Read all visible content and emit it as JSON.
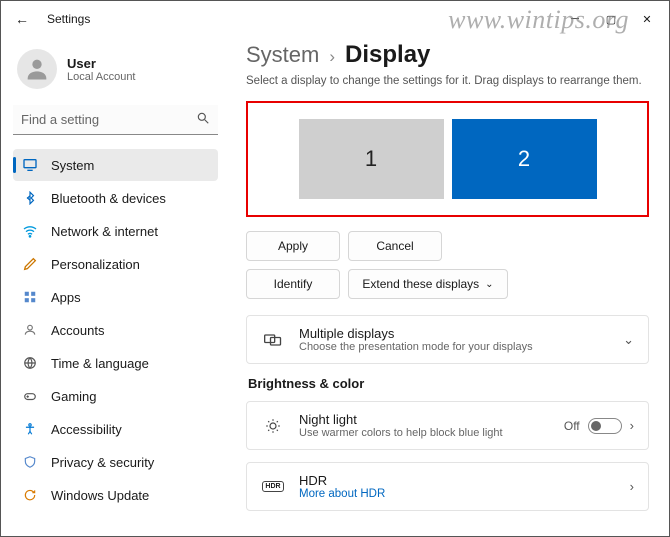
{
  "titlebar": {
    "title": "Settings"
  },
  "user": {
    "name": "User",
    "sub": "Local Account"
  },
  "search": {
    "placeholder": "Find a setting"
  },
  "nav": {
    "system": "System",
    "bluetooth": "Bluetooth & devices",
    "network": "Network & internet",
    "personalization": "Personalization",
    "apps": "Apps",
    "accounts": "Accounts",
    "time": "Time & language",
    "gaming": "Gaming",
    "accessibility": "Accessibility",
    "privacy": "Privacy & security",
    "update": "Windows Update"
  },
  "breadcrumb": {
    "parent": "System",
    "sep": "›",
    "current": "Display"
  },
  "subtitle": "Select a display to change the settings for it. Drag displays to rearrange them.",
  "monitors": {
    "m1": "1",
    "m2": "2"
  },
  "buttons": {
    "apply": "Apply",
    "cancel": "Cancel",
    "identify": "Identify",
    "extend": "Extend these displays"
  },
  "multi": {
    "title": "Multiple displays",
    "sub": "Choose the presentation mode for your displays"
  },
  "section_brightness": "Brightness & color",
  "night": {
    "title": "Night light",
    "sub": "Use warmer colors to help block blue light",
    "state": "Off"
  },
  "hdr": {
    "title": "HDR",
    "link": "More about HDR",
    "badge": "HDR"
  }
}
